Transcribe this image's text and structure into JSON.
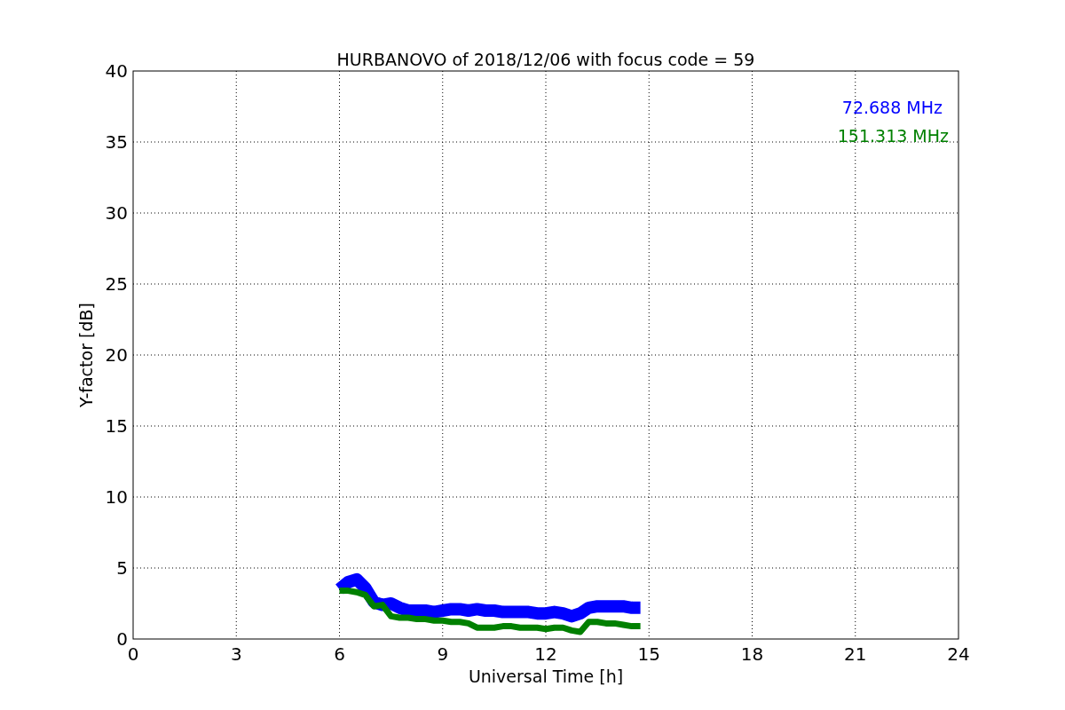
{
  "figure": {
    "chart_data": {
      "type": "line",
      "title": "HURBANOVO of 2018/12/06 with focus code = 59",
      "xlabel": "Universal Time [h]",
      "ylabel": "Y-factor [dB]",
      "x": [
        6,
        6.25,
        6.5,
        6.75,
        7,
        7.25,
        7.5,
        7.75,
        8,
        8.25,
        8.5,
        8.75,
        9,
        9.25,
        9.5,
        9.75,
        10,
        10.25,
        10.5,
        10.75,
        11,
        11.25,
        11.5,
        11.75,
        12,
        12.25,
        12.5,
        12.75,
        13,
        13.25,
        13.5,
        13.75,
        14,
        14.25,
        14.5,
        14.75
      ],
      "series": [
        {
          "name": "72.688 MHz",
          "color": "#0000ff",
          "values": [
            3.5,
            4.0,
            4.2,
            3.6,
            2.6,
            2.4,
            2.5,
            2.2,
            2.0,
            2.0,
            2.0,
            1.9,
            2.0,
            2.1,
            2.1,
            2.0,
            2.1,
            2.0,
            2.0,
            1.9,
            1.9,
            1.9,
            1.9,
            1.8,
            1.8,
            1.9,
            1.8,
            1.6,
            1.8,
            2.2,
            2.3,
            2.3,
            2.3,
            2.3,
            2.2,
            2.2
          ]
        },
        {
          "name": "151.313 MHz",
          "color": "#008000",
          "values": [
            3.4,
            3.4,
            3.3,
            3.1,
            2.3,
            2.4,
            1.6,
            1.5,
            1.5,
            1.4,
            1.4,
            1.3,
            1.3,
            1.2,
            1.2,
            1.1,
            0.8,
            0.8,
            0.8,
            0.9,
            0.9,
            0.8,
            0.8,
            0.8,
            0.7,
            0.8,
            0.8,
            0.6,
            0.5,
            1.2,
            1.2,
            1.1,
            1.1,
            1.0,
            0.9,
            0.9
          ]
        }
      ],
      "grid": true,
      "xlim": [
        0,
        24
      ],
      "ylim": [
        0,
        40
      ],
      "xticks": [
        0,
        3,
        6,
        9,
        12,
        15,
        18,
        21,
        24
      ],
      "yticks": [
        0,
        5,
        10,
        15,
        20,
        25,
        30,
        35,
        40
      ]
    }
  }
}
